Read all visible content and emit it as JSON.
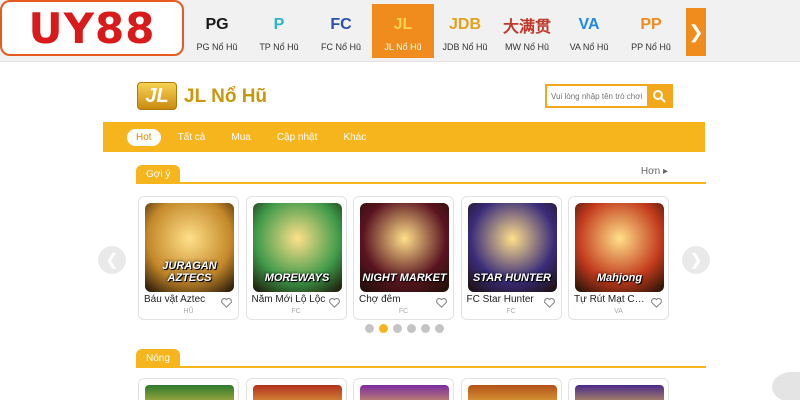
{
  "brand": {
    "name": "UY88"
  },
  "providers": [
    {
      "logo": "PG",
      "label": "PG Nổ Hũ",
      "active": false,
      "color": "#1a1a1a"
    },
    {
      "logo": "P",
      "label": "TP Nổ Hũ",
      "active": false,
      "color": "#2ab4c8"
    },
    {
      "logo": "FC",
      "label": "FC Nổ Hũ",
      "active": false,
      "color": "#2a4fb0"
    },
    {
      "logo": "JL",
      "label": "JL Nổ Hũ",
      "active": true,
      "color": "#f7d253"
    },
    {
      "logo": "JDB",
      "label": "JDB Nổ Hũ",
      "active": false,
      "color": "#e4a11d"
    },
    {
      "logo": "大满贯",
      "label": "MW Nổ Hũ",
      "active": false,
      "color": "#c0392b"
    },
    {
      "logo": "VA",
      "label": "VA Nổ Hũ",
      "active": false,
      "color": "#1e88e5"
    },
    {
      "logo": "PP",
      "label": "PP Nổ Hũ",
      "active": false,
      "color": "#f08b1d"
    }
  ],
  "header": {
    "logo_text": "JL",
    "title": "JL Nổ Hũ",
    "search_placeholder": "Vui lòng nhập tên trò chơi"
  },
  "tabs": [
    {
      "label": "Hot",
      "active": true
    },
    {
      "label": "Tất cả",
      "active": false
    },
    {
      "label": "Mua",
      "active": false
    },
    {
      "label": "Cập nhật",
      "active": false
    },
    {
      "label": "Khác",
      "active": false
    }
  ],
  "suggest": {
    "title": "Gợi ý",
    "more": "Hơn",
    "games": [
      {
        "name": "Báu vật Aztec",
        "provider": "HŨ",
        "art": "JURAGAN AZTECS",
        "bg": "#c4882a"
      },
      {
        "name": "Năm Mới Lộ Lộc",
        "provider": "FC",
        "art": "MOREWAYS",
        "bg": "#3f9a4a"
      },
      {
        "name": "Chợ đêm",
        "provider": "FC",
        "art": "NIGHT MARKET",
        "bg": "#5a1420"
      },
      {
        "name": "FC Star Hunter",
        "provider": "FC",
        "art": "STAR HUNTER",
        "bg": "#3a2c7a"
      },
      {
        "name": "Tự Rút Mạt Chược",
        "provider": "VA",
        "art": "Mahjong",
        "bg": "#c23a1c"
      }
    ]
  },
  "carousel": {
    "page_count": 6,
    "active_index": 1
  },
  "hot": {
    "title": "Nóng",
    "thumbs": [
      "#2d7a2e",
      "#b0301e",
      "#7a2aa0",
      "#b3521a",
      "#4a2a8a"
    ]
  },
  "colors": {
    "accent": "#f6b41d",
    "brand_red": "#d81a1a",
    "provider_active": "#f08b1d"
  }
}
